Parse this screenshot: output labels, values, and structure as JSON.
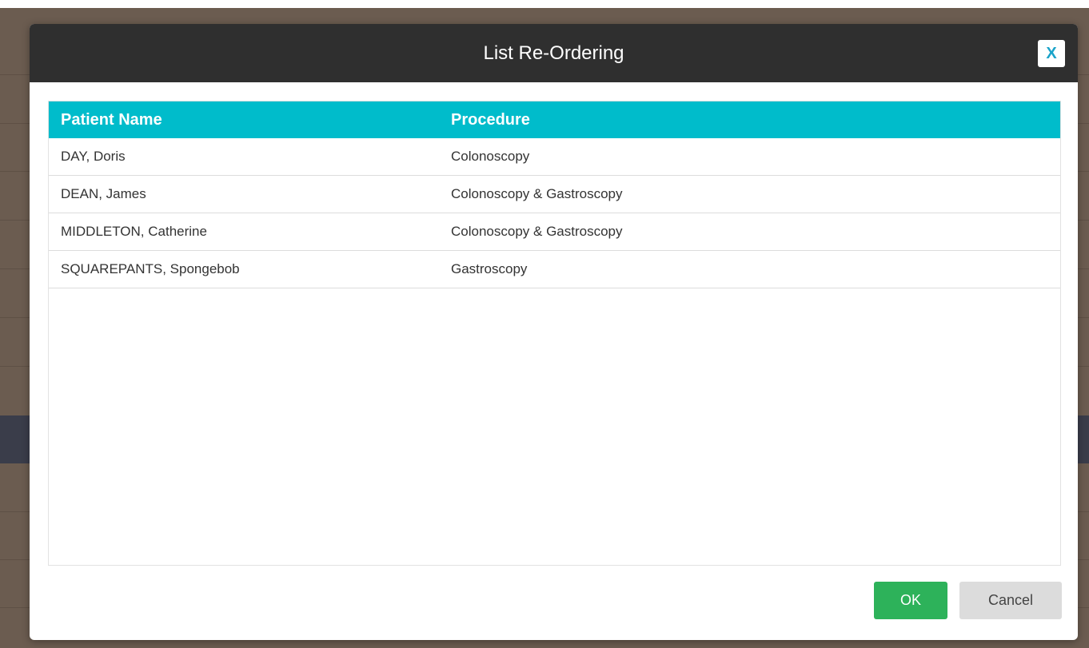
{
  "modal": {
    "title": "List Re-Ordering",
    "close_label": "X",
    "columns": [
      "Patient Name",
      "Procedure"
    ],
    "rows": [
      {
        "name": "DAY, Doris",
        "procedure": "Colonoscopy"
      },
      {
        "name": "DEAN, James",
        "procedure": "Colonoscopy & Gastroscopy"
      },
      {
        "name": "MIDDLETON, Catherine",
        "procedure": "Colonoscopy & Gastroscopy"
      },
      {
        "name": "SQUAREPANTS, Spongebob",
        "procedure": "Gastroscopy"
      }
    ],
    "ok_label": "OK",
    "cancel_label": "Cancel"
  },
  "colors": {
    "header_bg": "#2f2f2f",
    "table_header_bg": "#00bccb",
    "ok_bg": "#2db25a",
    "cancel_bg": "#dcdcdc",
    "close_icon": "#1aa3c9"
  }
}
